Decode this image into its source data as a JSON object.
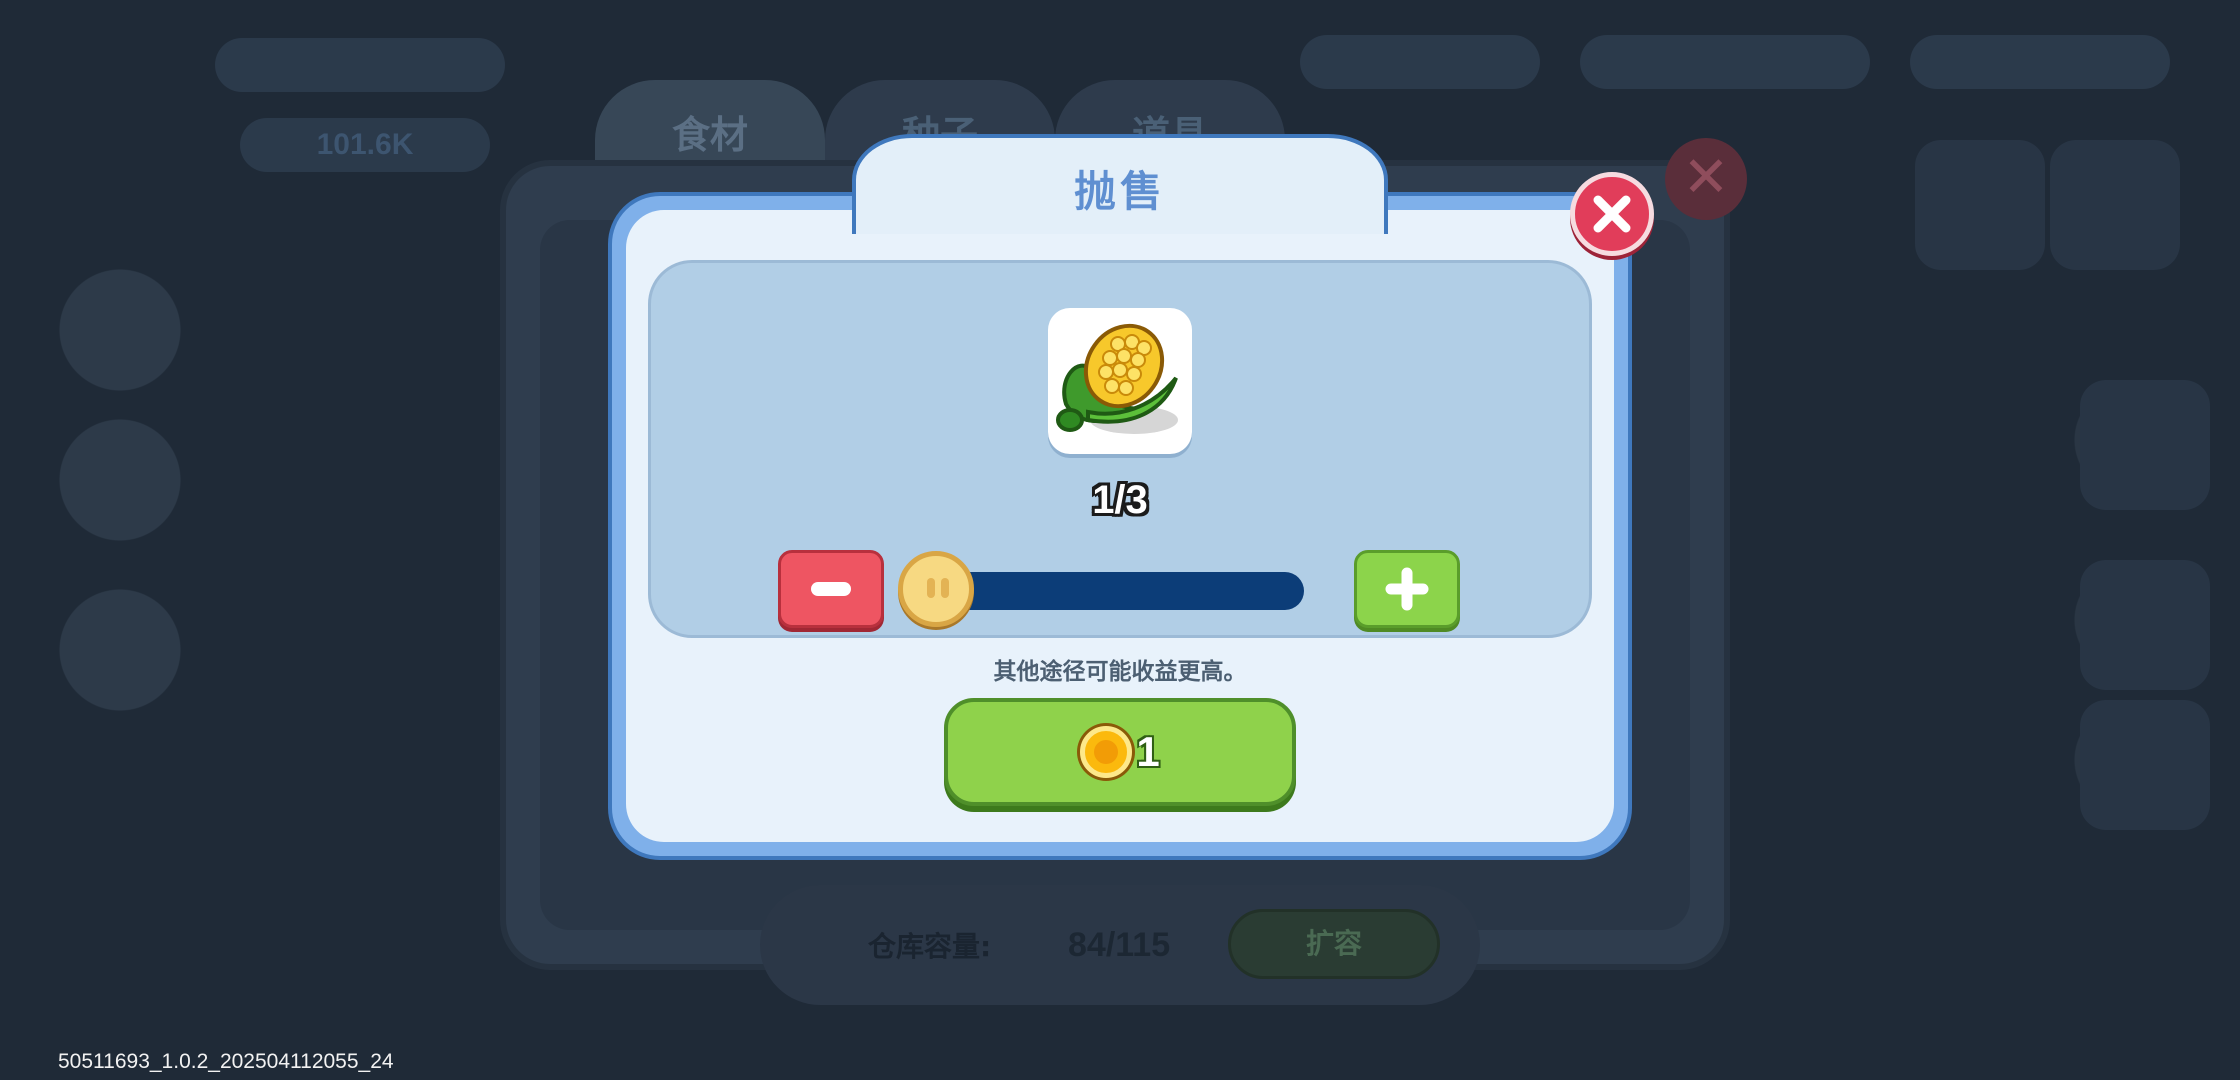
{
  "background": {
    "tabs": [
      {
        "label": "食材"
      },
      {
        "label": "种子"
      },
      {
        "label": "道具"
      }
    ],
    "warehouse_label": "仓库容量:",
    "warehouse_value": "84/115",
    "expand_label": "扩容",
    "top_left_stat": "101.6K"
  },
  "dialog": {
    "title": "抛售",
    "item_icon": "corn-icon",
    "count": "1/3",
    "quantity": {
      "current": 1,
      "max": 3
    },
    "hint": "其他途径可能收益更高。",
    "sell_price": "1",
    "close_icon": "close-icon"
  },
  "footer": {
    "version": "50511693_1.0.2_202504112055_24"
  },
  "colors": {
    "dialog_border": "#3f78bd",
    "title": "#5f8fd1",
    "close": "#e13d5a",
    "minus": "#ee5562",
    "plus": "#8cd44b",
    "slider_track": "#0c3d78",
    "sell_button": "#8fd24b",
    "coin": "#fbb90d"
  }
}
